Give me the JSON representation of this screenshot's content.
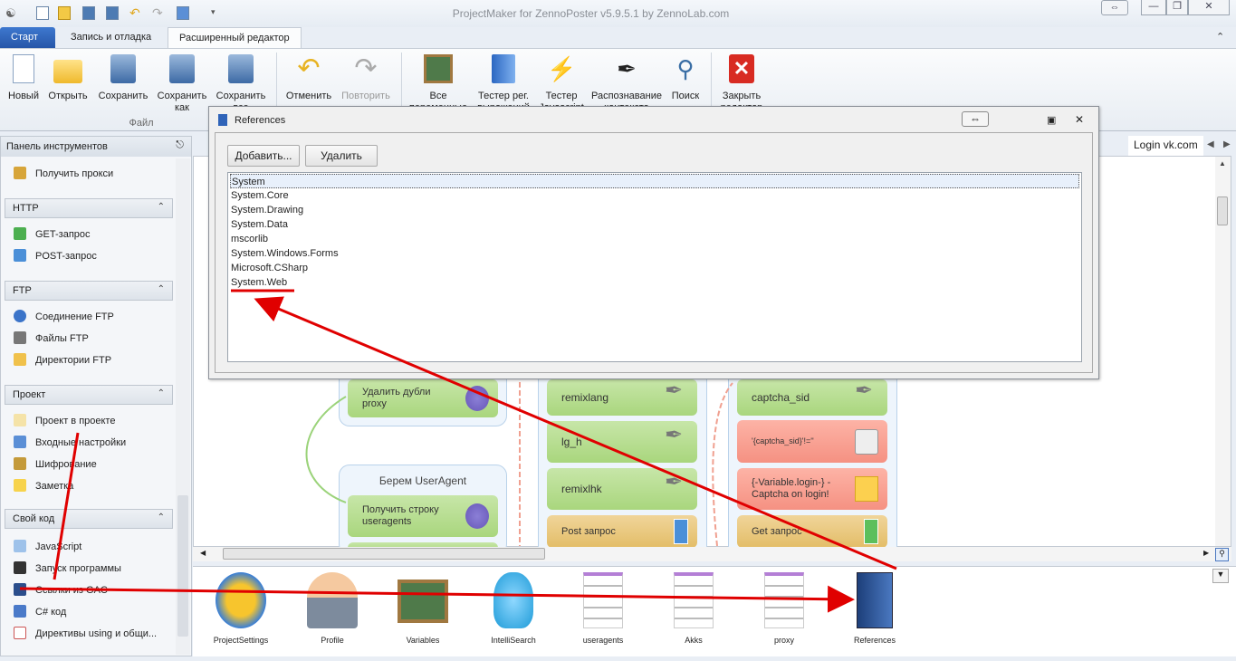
{
  "window": {
    "title": "ProjectMaker for ZennoPoster v5.9.5.1 by ZennoLab.com"
  },
  "ribbon_tabs": [
    "Старт",
    "Запись и отладка",
    "Расширенный редактор"
  ],
  "ribbon": {
    "file_group": "Файл",
    "buttons": [
      "Новый",
      "Открыть",
      "Сохранить",
      "Сохранить как",
      "Сохранить все",
      "Отменить",
      "Повторить",
      "Все переменные",
      "Тестер рег. выражений",
      "Тестер Javascript",
      "Распознавание контекста",
      "Поиск",
      "Закрыть редактор"
    ]
  },
  "left_panel": {
    "title": "Панель инструментов",
    "top_item": "Получить прокси",
    "sections": [
      {
        "title": "HTTP",
        "items": [
          "GET-запрос",
          "POST-запрос"
        ]
      },
      {
        "title": "FTP",
        "items": [
          "Соединение FTP",
          "Файлы FTP",
          "Директории FTP"
        ]
      },
      {
        "title": "Проект",
        "items": [
          "Проект в проекте",
          "Входные настройки",
          "Шифрование",
          "Заметка"
        ]
      },
      {
        "title": "Свой код",
        "items": [
          "JavaScript",
          "Запуск программы",
          "Ссылки из GAC",
          "C# код",
          "Директивы using и общи..."
        ]
      }
    ]
  },
  "doc_tab": "Login vk.com",
  "canvas": {
    "group_title": "Берем UserAgent",
    "nodes": [
      "Удалить дубли proxy",
      "Получить строку useragents",
      "remixlang",
      "lg_h",
      "remixlhk",
      "Post запрос",
      "captcha_sid",
      "'{captcha_sid}'!=''",
      "{-Variable.login-} - Captcha on login!",
      "Get запрос"
    ]
  },
  "resources": [
    "ProjectSettings",
    "Profile",
    "Variables",
    "IntelliSearch",
    "useragents",
    "Akks",
    "proxy",
    "References"
  ],
  "dialog": {
    "title": "References",
    "add_label": "Добавить...",
    "remove_label": "Удалить",
    "references": [
      "System",
      "System.Core",
      "System.Drawing",
      "System.Data",
      "mscorlib",
      "System.Windows.Forms",
      "Microsoft.CSharp",
      "System.Web"
    ],
    "selected": "System"
  },
  "colors": {
    "accent": "#2f63b8",
    "annotation": "#e00000"
  }
}
